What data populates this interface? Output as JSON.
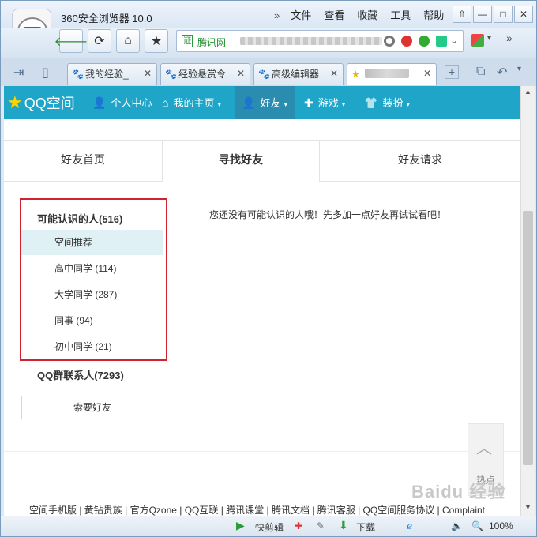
{
  "browser": {
    "title": "360安全浏览器 10.0",
    "menu": [
      "文件",
      "查看",
      "收藏",
      "工具",
      "帮助"
    ],
    "menu_overflow": "»",
    "address": {
      "site_label": "腾讯网",
      "cert_label": "证"
    },
    "tabs": [
      {
        "label": "我的经验_"
      },
      {
        "label": "经验悬赏令"
      },
      {
        "label": "高级编辑器"
      },
      {
        "label": ""
      }
    ],
    "window_buttons": {
      "pin": "⇧",
      "minimize": "—",
      "maximize": "□",
      "close": "✕"
    }
  },
  "qzone": {
    "brand": "QQ空间",
    "nav": [
      {
        "label": "个人中心",
        "icon": "person-icon",
        "dropdown": false
      },
      {
        "label": "我的主页",
        "icon": "home-icon",
        "dropdown": true
      },
      {
        "label": "好友",
        "icon": "friends-icon",
        "dropdown": true,
        "selected": true
      },
      {
        "label": "游戏",
        "icon": "game-icon",
        "dropdown": true
      },
      {
        "label": "装扮",
        "icon": "shirt-icon",
        "dropdown": true
      }
    ],
    "tabs": [
      {
        "label": "好友首页"
      },
      {
        "label": "寻找好友",
        "selected": true
      },
      {
        "label": "好友请求"
      }
    ],
    "sidebar": {
      "group1": "可能认识的人(516)",
      "items": [
        {
          "label": "空间推荐",
          "selected": true
        },
        {
          "label": "高中同学 (114)"
        },
        {
          "label": "大学同学 (287)"
        },
        {
          "label": "同事 (94)"
        },
        {
          "label": "初中同学 (21)"
        }
      ],
      "group2": "QQ群联系人(7293)",
      "ask_button": "索要好友"
    },
    "message": "您还没有可能认识的人哦！先多加一点好友再试试看吧！",
    "footer": "空间手机版 | 黄钻贵族 | 官方Qzone | QQ互联 | 腾讯课堂 | 腾讯文档 | 腾讯客服 | QQ空间服务协议 | Complaint",
    "hot": "热点"
  },
  "statusbar": {
    "quick_clip": "快剪辑",
    "download": "下载",
    "zoom": "100%"
  },
  "watermark": "Baidu 经验",
  "colors": {
    "accent": "#1ea5c8",
    "highlight_box": "#d0232f"
  }
}
